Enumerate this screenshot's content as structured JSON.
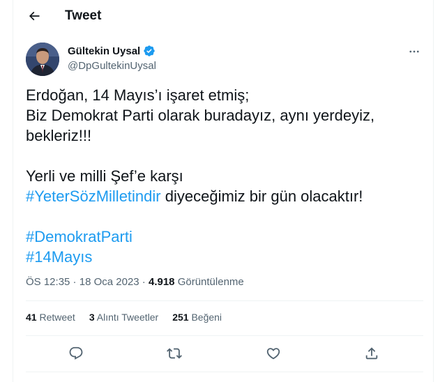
{
  "header": {
    "title": "Tweet"
  },
  "author": {
    "display_name": "Gültekin Uysal",
    "handle": "@DpGultekinUysal",
    "verified": true
  },
  "tweet": {
    "lines": [
      "Erdoğan, 14 Mayıs’ı işaret etmiş;",
      "Biz Demokrat Parti olarak buradayız, aynı yerdeyiz,",
      "bekleriz!!!",
      "Yerli ve milli Şef’e karşı",
      " diyeceğimiz bir gün olacaktır!"
    ],
    "hashtags": [
      "#YeterSözMilletindir",
      "#DemokratParti",
      "#14Mayıs"
    ]
  },
  "meta": {
    "time": "ÖS 12:35",
    "sep1": " · ",
    "date": "18 Oca 2023",
    "sep2": " · ",
    "views": "4.918",
    "views_label": " Görüntülenme"
  },
  "stats": {
    "retweets_count": "41",
    "retweets_label": " Retweet",
    "quotes_count": "3",
    "quotes_label": " Alıntı Tweetler",
    "likes_count": "251",
    "likes_label": " Beğeni"
  },
  "icons": {
    "back": "arrow-left-icon",
    "more": "more-horizontal-icon",
    "verified": "verified-badge-icon",
    "reply": "reply-icon",
    "retweet": "retweet-icon",
    "like": "heart-icon",
    "share": "share-icon"
  },
  "colors": {
    "accent": "#1d9bf0",
    "text": "#0f1419",
    "secondary": "#536471",
    "divider": "#eff3f4"
  }
}
